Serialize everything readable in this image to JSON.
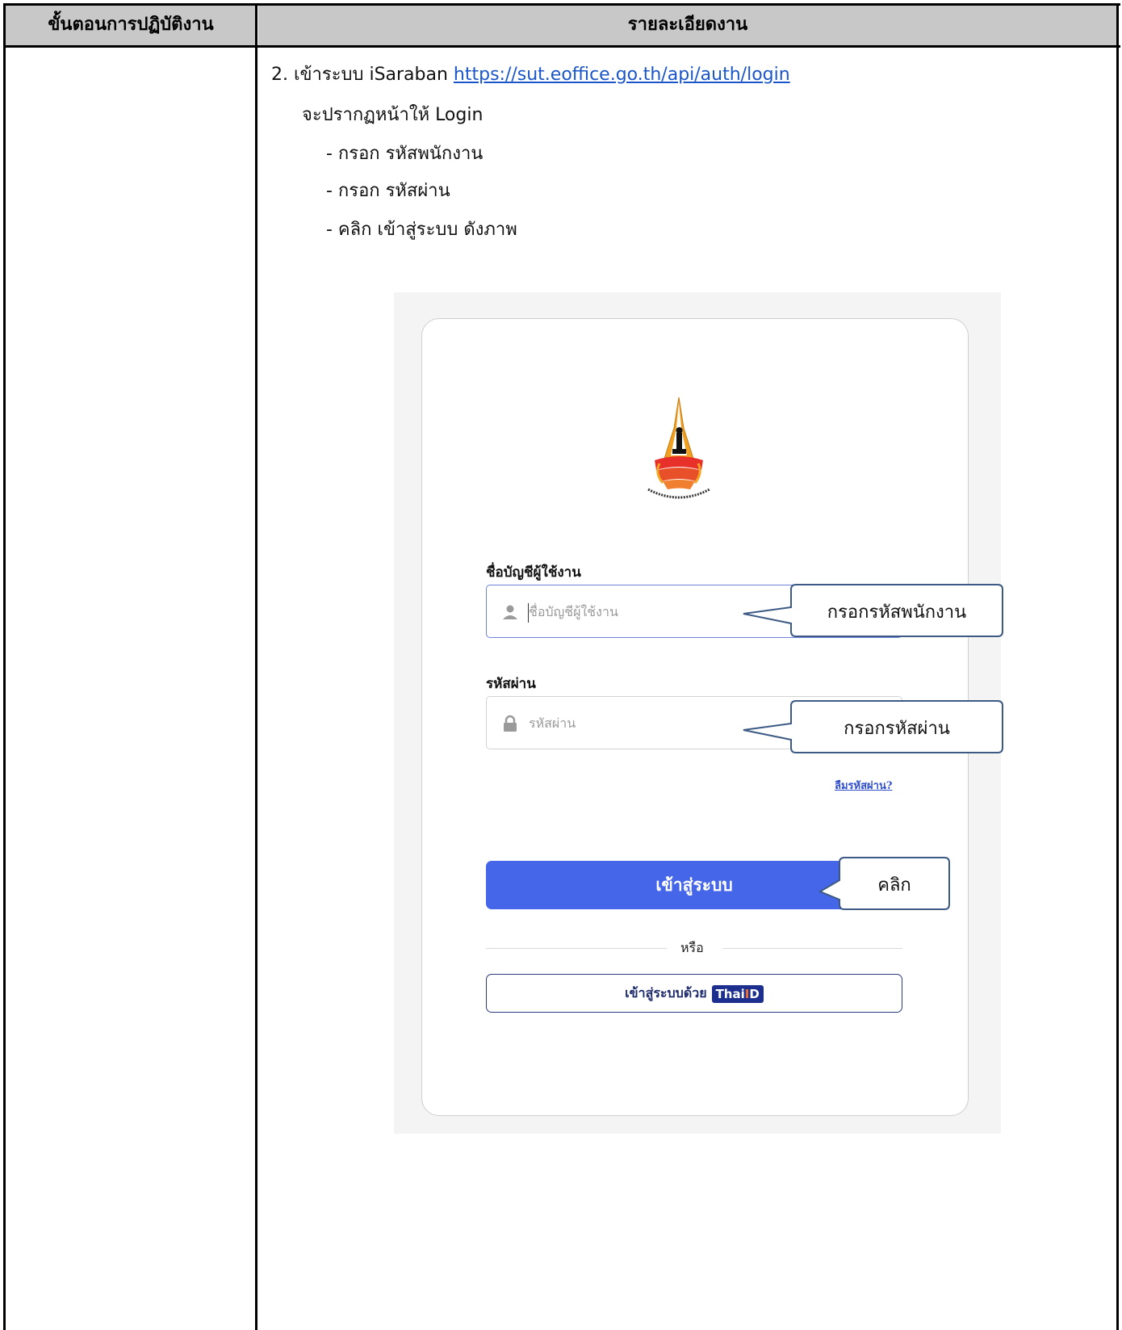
{
  "table": {
    "header_left": "ขั้นตอนการปฏิบัติงาน",
    "header_right": "รายละเอียดงาน"
  },
  "instructions": {
    "step_prefix": "2. เข้าระบบ iSaraban ",
    "url": "https://sut.eoffice.go.th/api/auth/login",
    "line2": "จะปรากฏหน้าให้ Login",
    "bullet1": "-  กรอก  รหัสพนักงาน",
    "bullet2": "-  กรอก  รหัสผ่าน",
    "bullet3": "-  คลิก เข้าสู่ระบบ  ดังภาพ"
  },
  "login": {
    "username_label": "ชื่อบัญชีผู้ใช้งาน",
    "username_placeholder": "ชื่อบัญชีผู้ใช้งาน",
    "password_label": "รหัสผ่าน",
    "password_placeholder": "รหัสผ่าน",
    "forgot_link": "ลืมรหัสผ่าน?",
    "login_button": "เข้าสู่ระบบ",
    "or_text": "หรือ",
    "thaid_button": "เข้าสู่ระบบด้วย",
    "thaid_badge_a": "Thai",
    "thaid_badge_b": "D",
    "thaid_badge_i": "I"
  },
  "callouts": {
    "username": "กรอกรหัสพนักงาน",
    "password": "กรอกรหัสผ่าน",
    "click": "คลิก"
  },
  "colors": {
    "login_button": "#4566e8",
    "link": "#1a56c9",
    "callout_border": "#3d5a84",
    "header_bg": "#c8c8c8"
  },
  "icons": {
    "username": "user-icon",
    "password": "lock-icon"
  }
}
